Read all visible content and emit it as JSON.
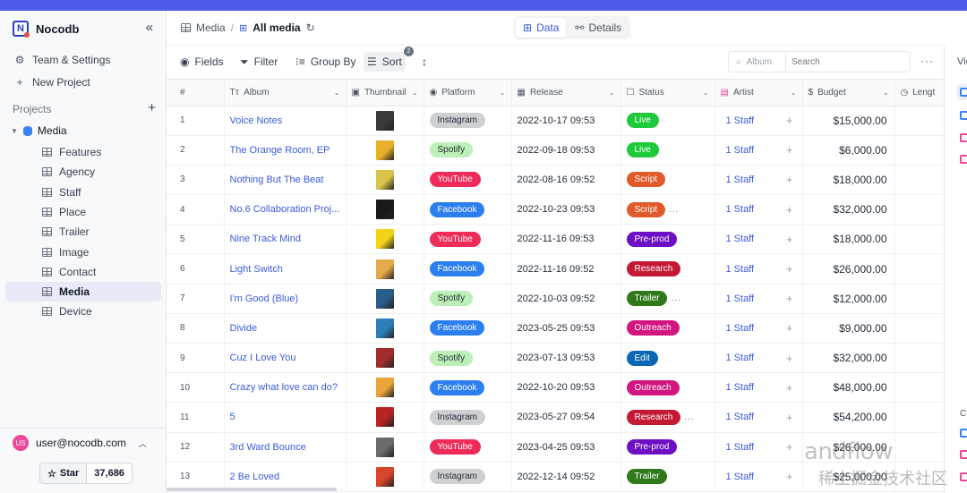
{
  "app": {
    "name": "Nocodb"
  },
  "sidebar": {
    "links": [
      {
        "label": "Team & Settings",
        "icon": "gear-icon"
      },
      {
        "label": "New Project",
        "icon": "plus-icon"
      }
    ],
    "projects_heading": "Projects",
    "project": {
      "name": "Media"
    },
    "tables": [
      {
        "label": "Features"
      },
      {
        "label": "Agency"
      },
      {
        "label": "Staff"
      },
      {
        "label": "Place"
      },
      {
        "label": "Trailer"
      },
      {
        "label": "Image"
      },
      {
        "label": "Contact"
      },
      {
        "label": "Media",
        "active": true
      },
      {
        "label": "Device"
      }
    ],
    "user": {
      "email": "user@nocodb.com",
      "initials": "US"
    },
    "github": {
      "star_label": "Star",
      "star_count": "37,686"
    }
  },
  "breadcrumb": {
    "base": "Media",
    "view": "All media"
  },
  "view_tabs": [
    {
      "label": "Data",
      "active": true
    },
    {
      "label": "Details",
      "active": false
    }
  ],
  "toolbar": {
    "fields_label": "Fields",
    "filter_label": "Filter",
    "group_label": "Group By",
    "sort_label": "Sort",
    "sort_count": "2",
    "search_field": "Album",
    "search_placeholder": "Search"
  },
  "columns": [
    {
      "label": "#"
    },
    {
      "label": "Album",
      "icon": "text-icon"
    },
    {
      "label": "Thumbnail",
      "icon": "attachment-icon"
    },
    {
      "label": "Platform",
      "icon": "single-select-icon"
    },
    {
      "label": "Release",
      "icon": "calendar-icon"
    },
    {
      "label": "Status",
      "icon": "checkbox-icon"
    },
    {
      "label": "Artist",
      "icon": "link-icon"
    },
    {
      "label": "Budget",
      "icon": "dollar-icon"
    },
    {
      "label": "Lengt",
      "icon": "clock-icon"
    }
  ],
  "rows": [
    {
      "n": "1",
      "album": "Voice Notes",
      "platform": "Instagram",
      "release": "2022-10-17 09:53",
      "status": "Live",
      "artist": "1 Staff",
      "budget": "$15,000.00"
    },
    {
      "n": "2",
      "album": "The Orange Room, EP",
      "platform": "Spotify",
      "release": "2022-09-18 09:53",
      "status": "Live",
      "artist": "1 Staff",
      "budget": "$6,000.00"
    },
    {
      "n": "3",
      "album": "Nothing But The Beat",
      "platform": "YouTube",
      "release": "2022-08-16 09:52",
      "status": "Script",
      "artist": "1 Staff",
      "budget": "$18,000.00"
    },
    {
      "n": "4",
      "album": "No.6 Collaboration Proj...",
      "platform": "Facebook",
      "release": "2022-10-23 09:53",
      "status": "Script",
      "artist": "1 Staff",
      "budget": "$32,000.00",
      "more": "..."
    },
    {
      "n": "5",
      "album": "Nine Track Mind",
      "platform": "YouTube",
      "release": "2022-11-16 09:53",
      "status": "Pre-prod",
      "artist": "1 Staff",
      "budget": "$18,000.00"
    },
    {
      "n": "6",
      "album": "Light Switch",
      "platform": "Facebook",
      "release": "2022-11-16 09:52",
      "status": "Research",
      "artist": "1 Staff",
      "budget": "$26,000.00"
    },
    {
      "n": "7",
      "album": "I'm Good (Blue)",
      "platform": "Spotify",
      "release": "2022-10-03 09:52",
      "status": "Trailer",
      "artist": "1 Staff",
      "budget": "$12,000.00",
      "more": "..."
    },
    {
      "n": "8",
      "album": "Divide",
      "platform": "Facebook",
      "release": "2023-05-25 09:53",
      "status": "Outreach",
      "artist": "1 Staff",
      "budget": "$9,000.00"
    },
    {
      "n": "9",
      "album": "Cuz I Love You",
      "platform": "Spotify",
      "release": "2023-07-13 09:53",
      "status": "Edit",
      "artist": "1 Staff",
      "budget": "$32,000.00"
    },
    {
      "n": "10",
      "album": "Crazy what love can do?",
      "platform": "Facebook",
      "release": "2022-10-20 09:53",
      "status": "Outreach",
      "artist": "1 Staff",
      "budget": "$48,000.00"
    },
    {
      "n": "11",
      "album": "5",
      "platform": "Instagram",
      "release": "2023-05-27 09:54",
      "status": "Research",
      "artist": "1 Staff",
      "budget": "$54,200.00",
      "more": "..."
    },
    {
      "n": "12",
      "album": "3rd Ward Bounce",
      "platform": "YouTube",
      "release": "2023-04-25 09:53",
      "status": "Pre-prod",
      "artist": "1 Staff",
      "budget": "$26,000.00"
    },
    {
      "n": "13",
      "album": "2 Be Loved",
      "platform": "Instagram",
      "release": "2022-12-14 09:52",
      "status": "Trailer",
      "artist": "1 Staff",
      "budget": "$25,000.00"
    }
  ],
  "platform_colors": {
    "Instagram": {
      "bg": "#cfd0d2",
      "fg": "#1f2937"
    },
    "Spotify": {
      "bg": "#bdf0b8",
      "fg": "#1f2937"
    },
    "YouTube": {
      "bg": "#ee2c5a",
      "fg": "#ffffff"
    },
    "Facebook": {
      "bg": "#2b7fee",
      "fg": "#ffffff"
    }
  },
  "status_colors": {
    "Live": "#1fca3a",
    "Script": "#e05a2b",
    "Pre-prod": "#6d0fc3",
    "Research": "#c31934",
    "Trailer": "#2e7a1b",
    "Outreach": "#d2157f",
    "Edit": "#0a67b3"
  },
  "thumb_colors": [
    "#3a3a3a",
    "#e8b02a",
    "#d9c44a",
    "#1a1a1a",
    "#f3d318",
    "#e3a94a",
    "#2b5d8a",
    "#2c7fb8",
    "#a32b2b",
    "#e9a53a",
    "#b82323",
    "#6b6b6b",
    "#d7452a"
  ],
  "right_panel": {
    "label": "Vie",
    "section_label": "Cr"
  },
  "watermark": {
    "line1": "andflow",
    "line2": "稀土掘金技术社区"
  }
}
